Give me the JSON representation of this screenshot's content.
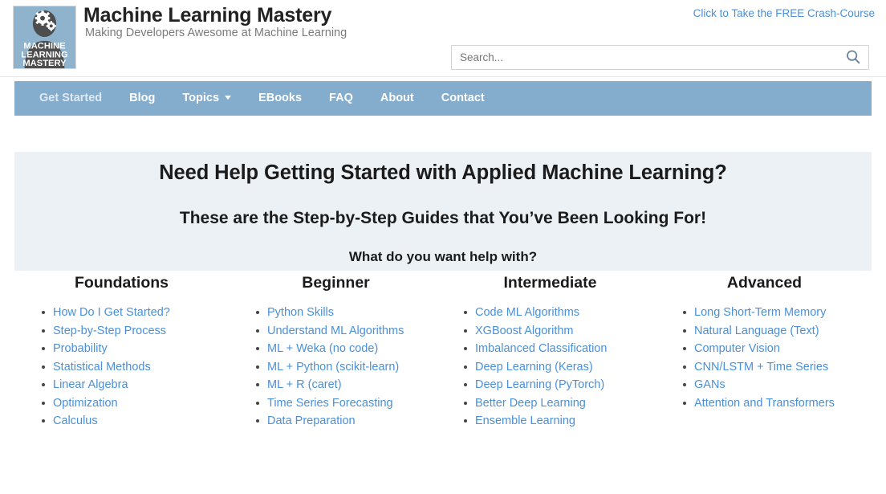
{
  "header": {
    "site_title": "Machine Learning Mastery",
    "tagline": "Making Developers Awesome at Machine Learning",
    "crash_course_link": "Click to Take the FREE Crash-Course",
    "logo_lines": [
      "MACHINE",
      "LEARNING",
      "MASTERY"
    ],
    "logo_alt": "machine-learning-mastery-logo"
  },
  "search": {
    "placeholder": "Search...",
    "value": "",
    "icon": "search-icon"
  },
  "nav": {
    "items": [
      {
        "label": "Get Started",
        "state": "dim",
        "caret": false
      },
      {
        "label": "Blog",
        "state": "normal",
        "caret": false
      },
      {
        "label": "Topics",
        "state": "normal",
        "caret": true
      },
      {
        "label": "EBooks",
        "state": "normal",
        "caret": false
      },
      {
        "label": "FAQ",
        "state": "normal",
        "caret": false
      },
      {
        "label": "About",
        "state": "normal",
        "caret": false
      },
      {
        "label": "Contact",
        "state": "normal",
        "caret": false
      }
    ]
  },
  "hero": {
    "heading": "Need Help Getting Started with Applied Machine Learning?",
    "subheading": "These are the Step-by-Step Guides that You’ve Been Looking For!",
    "prompt": "What do you want help with?"
  },
  "columns": [
    {
      "title": "Foundations",
      "items": [
        "How Do I Get Started?",
        "Step-by-Step Process",
        "Probability",
        "Statistical Methods",
        "Linear Algebra",
        "Optimization",
        "Calculus"
      ]
    },
    {
      "title": "Beginner",
      "items": [
        "Python Skills",
        "Understand ML Algorithms",
        "ML + Weka (no code)",
        "ML + Python (scikit-learn)",
        "ML + R (caret)",
        "Time Series Forecasting",
        "Data Preparation"
      ]
    },
    {
      "title": "Intermediate",
      "items": [
        "Code ML Algorithms",
        "XGBoost Algorithm",
        "Imbalanced Classification",
        "Deep Learning (Keras)",
        "Deep Learning (PyTorch)",
        "Better Deep Learning",
        "Ensemble Learning"
      ]
    },
    {
      "title": "Advanced",
      "items": [
        "Long Short-Term Memory",
        "Natural Language (Text)",
        "Computer Vision",
        "CNN/LSTM + Time Series",
        "GANs",
        "Attention and Transformers"
      ]
    }
  ],
  "colors": {
    "nav_bar": "#84accc",
    "hero_bg": "#ecf1f5",
    "link_blue": "#4a90d9",
    "logo_bg": "#8fb3cd",
    "logo_figure": "#4d4d4d"
  }
}
